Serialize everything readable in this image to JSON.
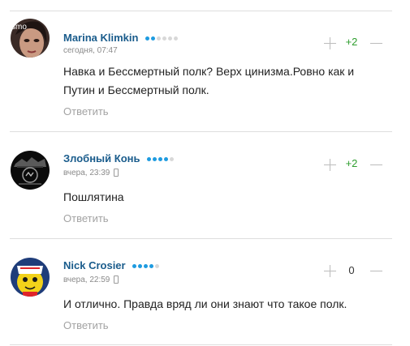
{
  "colors": {
    "author": "#1a5c8c",
    "rank_on": "#1e9be0",
    "rank_off": "#d8d8d8",
    "positive_rating": "#2e9e2e",
    "neutral_rating": "#333333",
    "reply": "#a3a3a3",
    "separator": "#dedede"
  },
  "comments": [
    {
      "author": "Marina Klimkin",
      "rank": {
        "filled": 2,
        "total": 6
      },
      "timestamp": "сегодня, 07:47",
      "device_icon": "",
      "avatar_icon": "photo-avatar-icon",
      "avatar_watermark": "smo",
      "text": "Навка и Бессмертный полк? Верх цинизма.Ровно как и Путин и Бессмертный полк.",
      "rating": "+2",
      "reply_label": "Ответить"
    },
    {
      "author": "Злобный Конь",
      "rank": {
        "filled": 4,
        "total": 5
      },
      "timestamp": "вчера, 23:39",
      "device_icon": "mobile-phone-icon",
      "avatar_icon": "dark-emblem-avatar-icon",
      "text": "Пошлятина",
      "rating": "+2",
      "reply_label": "Ответить"
    },
    {
      "author": "Nick Crosier",
      "rank": {
        "filled": 4,
        "total": 5
      },
      "timestamp": "вчера, 22:59",
      "device_icon": "mobile-phone-icon",
      "avatar_icon": "yellow-character-avatar-icon",
      "text": "И отлично. Правда вряд ли они знают что такое полк.",
      "rating": "0",
      "reply_label": "Ответить"
    }
  ]
}
